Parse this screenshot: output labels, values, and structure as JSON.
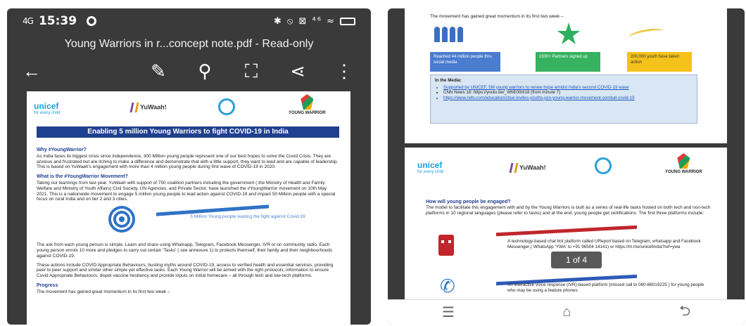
{
  "left": {
    "status": {
      "signal": "4G",
      "time": "15:39",
      "icons": "✱ ⦸ ⊠ ⁴⁶ ≈"
    },
    "title": "Young Warriors in r...concept note.pdf - Read-only",
    "toolbar": {
      "back": "←",
      "edit": "✎",
      "search": "⚲",
      "fullscreen": "⛶",
      "share": "⋖",
      "more": "⋮"
    },
    "logos": {
      "unicef": "unicef",
      "unicef_tag": "for every child",
      "yuwaah": "YuWaah!",
      "yw": "YOUNG WARRIOR"
    },
    "banner": "Enabling 5 million Young Warriors to fight COVID-19 in India",
    "why_heading": "Why #YoungWarrior?",
    "why_text": "As India faces its biggest crisis since independence, 300 Million young people represent one of our best hopes to solve the Covid Crisis. They are anxious and frustrated but are itching to make a difference and demonstrate that with a little support, they want to lead and are capable of leadership. This is based on YuWaah's engagement with more than 4 million young people during first wave of COVID-19 in 2020.",
    "what_heading": "What is the #YoungWarrior Movement?",
    "what_text": "Taking our learnings from last year, YuWaah with support of 750 coalition partners including the government ( the Ministry of Health and Family Welfare and Ministry of Youth Affairs) Civil Society, UN Agencies, and Private Sector, have launched the #YoungWarrior movement on 10th May 2021. This is a nationwide movement to engage 5 million young people to lead action against COVID-19 and impact 50 Million people with a special focus on rural India and on tier 2 and 3 cities.",
    "target_text": "5 Million Young people leading the fight against Covid-19",
    "ask_text": "The ask from each young person is simple. Learn and share using Whatsapp, Telegram, Facebook Messenger, IVR or on community radio. Each young person enrols 10 more and pledges to carry out certain 'Tasks' ( see annexure 1) to protects themself, their family and their neighbourhoods against COVID-19.",
    "actions_text": "These actions include COVID Appropriate Behaviours, busting myths around COVID-19, access to verified health and essential services, providing peer to peer support and similar other simple yet effective tasks. Each Young Warrior will be armed with the right protocols, information to ensure Covid Appropriate Behaviours, dispel vaccine hesitancy and provide inputs on initial homecare – all through tech and low-tech platforms.",
    "progress_heading": "Progress",
    "progress_text": "The movement has gained great momentum in its first two week –"
  },
  "right": {
    "top_text": "The movement has gained great momentum in its first two week –",
    "stats": [
      "Reached 44 million people thru social media",
      "1500+ Partners signed up",
      "200,000 youth have taken action"
    ],
    "media_heading": "In the Media:",
    "media_items": [
      "Supported by UNICEF, 5M young warriors to renew hope amidst India's second COVID-19 wave",
      "CNN News 18: https://youtu.be/_WhE00nI18 (from minute 7)",
      "https://www.ndtv.com/education/cbse-invites-youths-join-young-warrior-movement-combat-covid-19"
    ],
    "engage_heading": "How will young people be engaged?",
    "engage_text": "The model to facilitate this engagement with and by the Young Warriors is built as a series of real-life tasks hosted on both tech and non-tech platforms in 10 regional languages (please refer to tasks) and at the end, young people get certifications. The first three platforms include:",
    "item1": "A technology-based chat bot platform called UReport based on Telegram, whatsapp and Facebook Messenger ( WhatsApp 'YWA' to +91 96504 14141) or https://m.me/unicefindia?ref=ywa",
    "item2": "An interactive voice response (IVR)-based platform (missed call to 080-66019225 ) for young people who may be using a feature phones",
    "pager": "1 of 4",
    "nav": {
      "menu": "☰",
      "home": "⌂",
      "back": "⮌"
    }
  }
}
